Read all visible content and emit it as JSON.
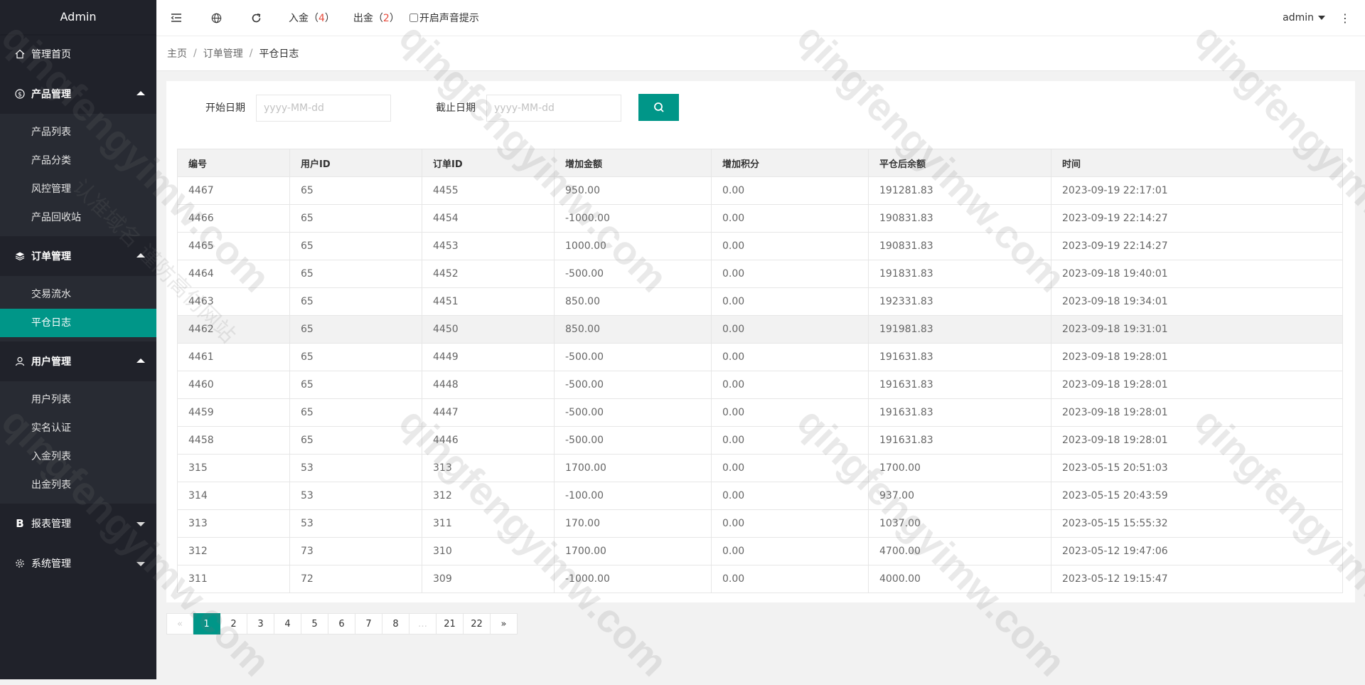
{
  "sidebar": {
    "logo": "Admin",
    "home": "管理首页",
    "groups": [
      {
        "title": "产品管理",
        "items": [
          "产品列表",
          "产品分类",
          "风控管理",
          "产品回收站"
        ]
      },
      {
        "title": "订单管理",
        "items": [
          "交易流水",
          "平仓日志"
        ]
      },
      {
        "title": "用户管理",
        "items": [
          "用户列表",
          "实名认证",
          "入金列表",
          "出金列表"
        ]
      },
      {
        "title": "报表管理"
      },
      {
        "title": "系统管理"
      }
    ],
    "active_item": "平仓日志"
  },
  "header": {
    "deposit_label": "入金（",
    "deposit_count": "4",
    "withdraw_label": "出金（",
    "withdraw_count": "2",
    "paren_close": "）",
    "sound_toggle": "开启声音提示",
    "user": "admin",
    "icons": [
      "menu-fold-icon",
      "globe-icon",
      "refresh-icon",
      "more-vertical-icon"
    ]
  },
  "breadcrumb": [
    "主页",
    "订单管理",
    "平仓日志"
  ],
  "breadcrumb_sep": "/",
  "filters": {
    "start_label": "开始日期",
    "start_placeholder": "yyyy-MM-dd",
    "end_label": "截止日期",
    "end_placeholder": "yyyy-MM-dd"
  },
  "table": {
    "headers": [
      "编号",
      "用户ID",
      "订单ID",
      "增加金额",
      "增加积分",
      "平仓后余额",
      "时间"
    ],
    "rows": [
      [
        "4467",
        "65",
        "4455",
        "950.00",
        "0.00",
        "191281.83",
        "2023-09-19 22:17:01"
      ],
      [
        "4466",
        "65",
        "4454",
        "-1000.00",
        "0.00",
        "190831.83",
        "2023-09-19 22:14:27"
      ],
      [
        "4465",
        "65",
        "4453",
        "1000.00",
        "0.00",
        "190831.83",
        "2023-09-19 22:14:27"
      ],
      [
        "4464",
        "65",
        "4452",
        "-500.00",
        "0.00",
        "191831.83",
        "2023-09-18 19:40:01"
      ],
      [
        "4463",
        "65",
        "4451",
        "850.00",
        "0.00",
        "192331.83",
        "2023-09-18 19:34:01"
      ],
      [
        "4462",
        "65",
        "4450",
        "850.00",
        "0.00",
        "191981.83",
        "2023-09-18 19:31:01"
      ],
      [
        "4461",
        "65",
        "4449",
        "-500.00",
        "0.00",
        "191631.83",
        "2023-09-18 19:28:01"
      ],
      [
        "4460",
        "65",
        "4448",
        "-500.00",
        "0.00",
        "191631.83",
        "2023-09-18 19:28:01"
      ],
      [
        "4459",
        "65",
        "4447",
        "-500.00",
        "0.00",
        "191631.83",
        "2023-09-18 19:28:01"
      ],
      [
        "4458",
        "65",
        "4446",
        "-500.00",
        "0.00",
        "191631.83",
        "2023-09-18 19:28:01"
      ],
      [
        "315",
        "53",
        "313",
        "1700.00",
        "0.00",
        "1700.00",
        "2023-05-15 20:51:03"
      ],
      [
        "314",
        "53",
        "312",
        "-100.00",
        "0.00",
        "937.00",
        "2023-05-15 20:43:59"
      ],
      [
        "313",
        "53",
        "311",
        "170.00",
        "0.00",
        "1037.00",
        "2023-05-15 15:55:32"
      ],
      [
        "312",
        "73",
        "310",
        "1700.00",
        "0.00",
        "4700.00",
        "2023-05-12 19:47:06"
      ],
      [
        "311",
        "72",
        "309",
        "-1000.00",
        "0.00",
        "4000.00",
        "2023-05-12 19:15:47"
      ]
    ],
    "highlighted_row": 5
  },
  "pagination": [
    "«",
    "1",
    "2",
    "3",
    "4",
    "5",
    "6",
    "7",
    "8",
    "…",
    "21",
    "22",
    "»"
  ],
  "pagination_current": "1",
  "watermarks": {
    "domain": "qingfengyimw.com",
    "slogan": "认准域名 谨防高仿网站"
  },
  "colors": {
    "accent": "#009688",
    "sidebar_bg": "#20222a",
    "count_red": "#e74c3c"
  }
}
